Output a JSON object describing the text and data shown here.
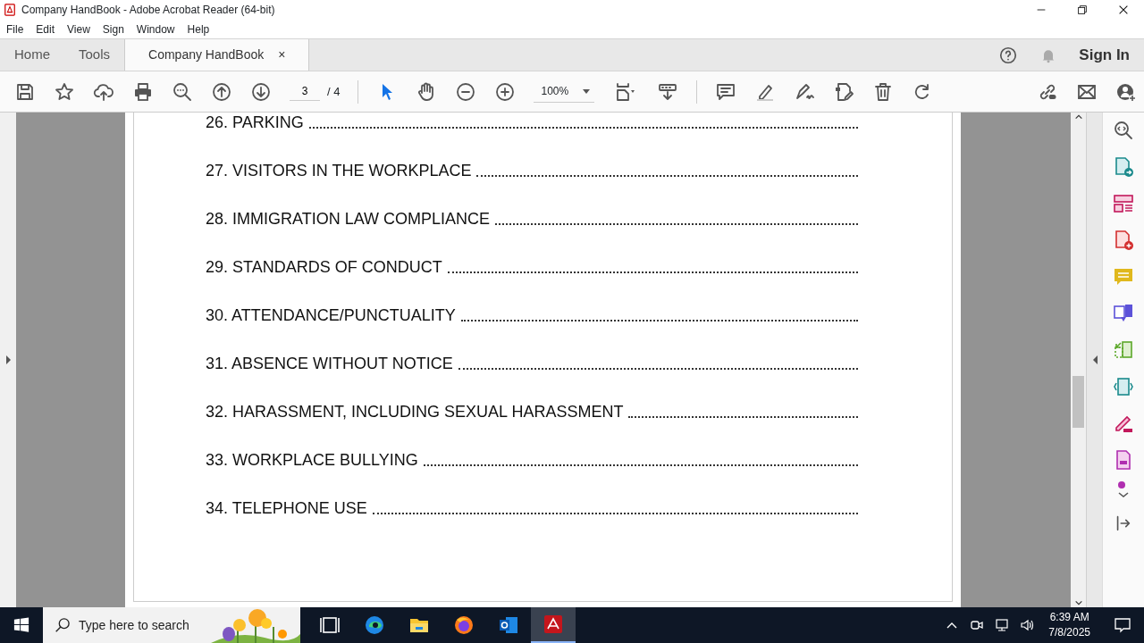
{
  "window": {
    "title": "Company HandBook - Adobe Acrobat Reader (64-bit)"
  },
  "menu": [
    "File",
    "Edit",
    "View",
    "Sign",
    "Window",
    "Help"
  ],
  "tabs": [
    {
      "label": "Home",
      "selected": false
    },
    {
      "label": "Tools",
      "selected": false
    },
    {
      "label": "Company HandBook",
      "selected": true,
      "close": "×"
    }
  ],
  "account": {
    "sign_in": "Sign In"
  },
  "toolbar": {
    "page": "3",
    "page_total": "/ 4",
    "zoom": "100%"
  },
  "document": {
    "entries": [
      "26. PARKING",
      "27. VISITORS IN THE WORKPLACE",
      "28. IMMIGRATION LAW COMPLIANCE",
      "29. STANDARDS OF CONDUCT",
      "30. ATTENDANCE/PUNCTUALITY",
      "31. ABSENCE WITHOUT NOTICE",
      "32. HARASSMENT, INCLUDING SEXUAL HARASSMENT",
      "33. WORKPLACE BULLYING",
      "34. TELEPHONE USE"
    ]
  },
  "taskbar": {
    "search": {
      "placeholder": "Type here to search"
    },
    "apps": [
      {
        "kind": "taskview",
        "selected": false
      },
      {
        "kind": "edge",
        "selected": false
      },
      {
        "kind": "explorer",
        "selected": false
      },
      {
        "kind": "firefox",
        "selected": false
      },
      {
        "kind": "outlook",
        "selected": false
      },
      {
        "kind": "acrobat",
        "selected": true
      }
    ],
    "time": "6:39 AM",
    "date": "7/8/2025"
  }
}
